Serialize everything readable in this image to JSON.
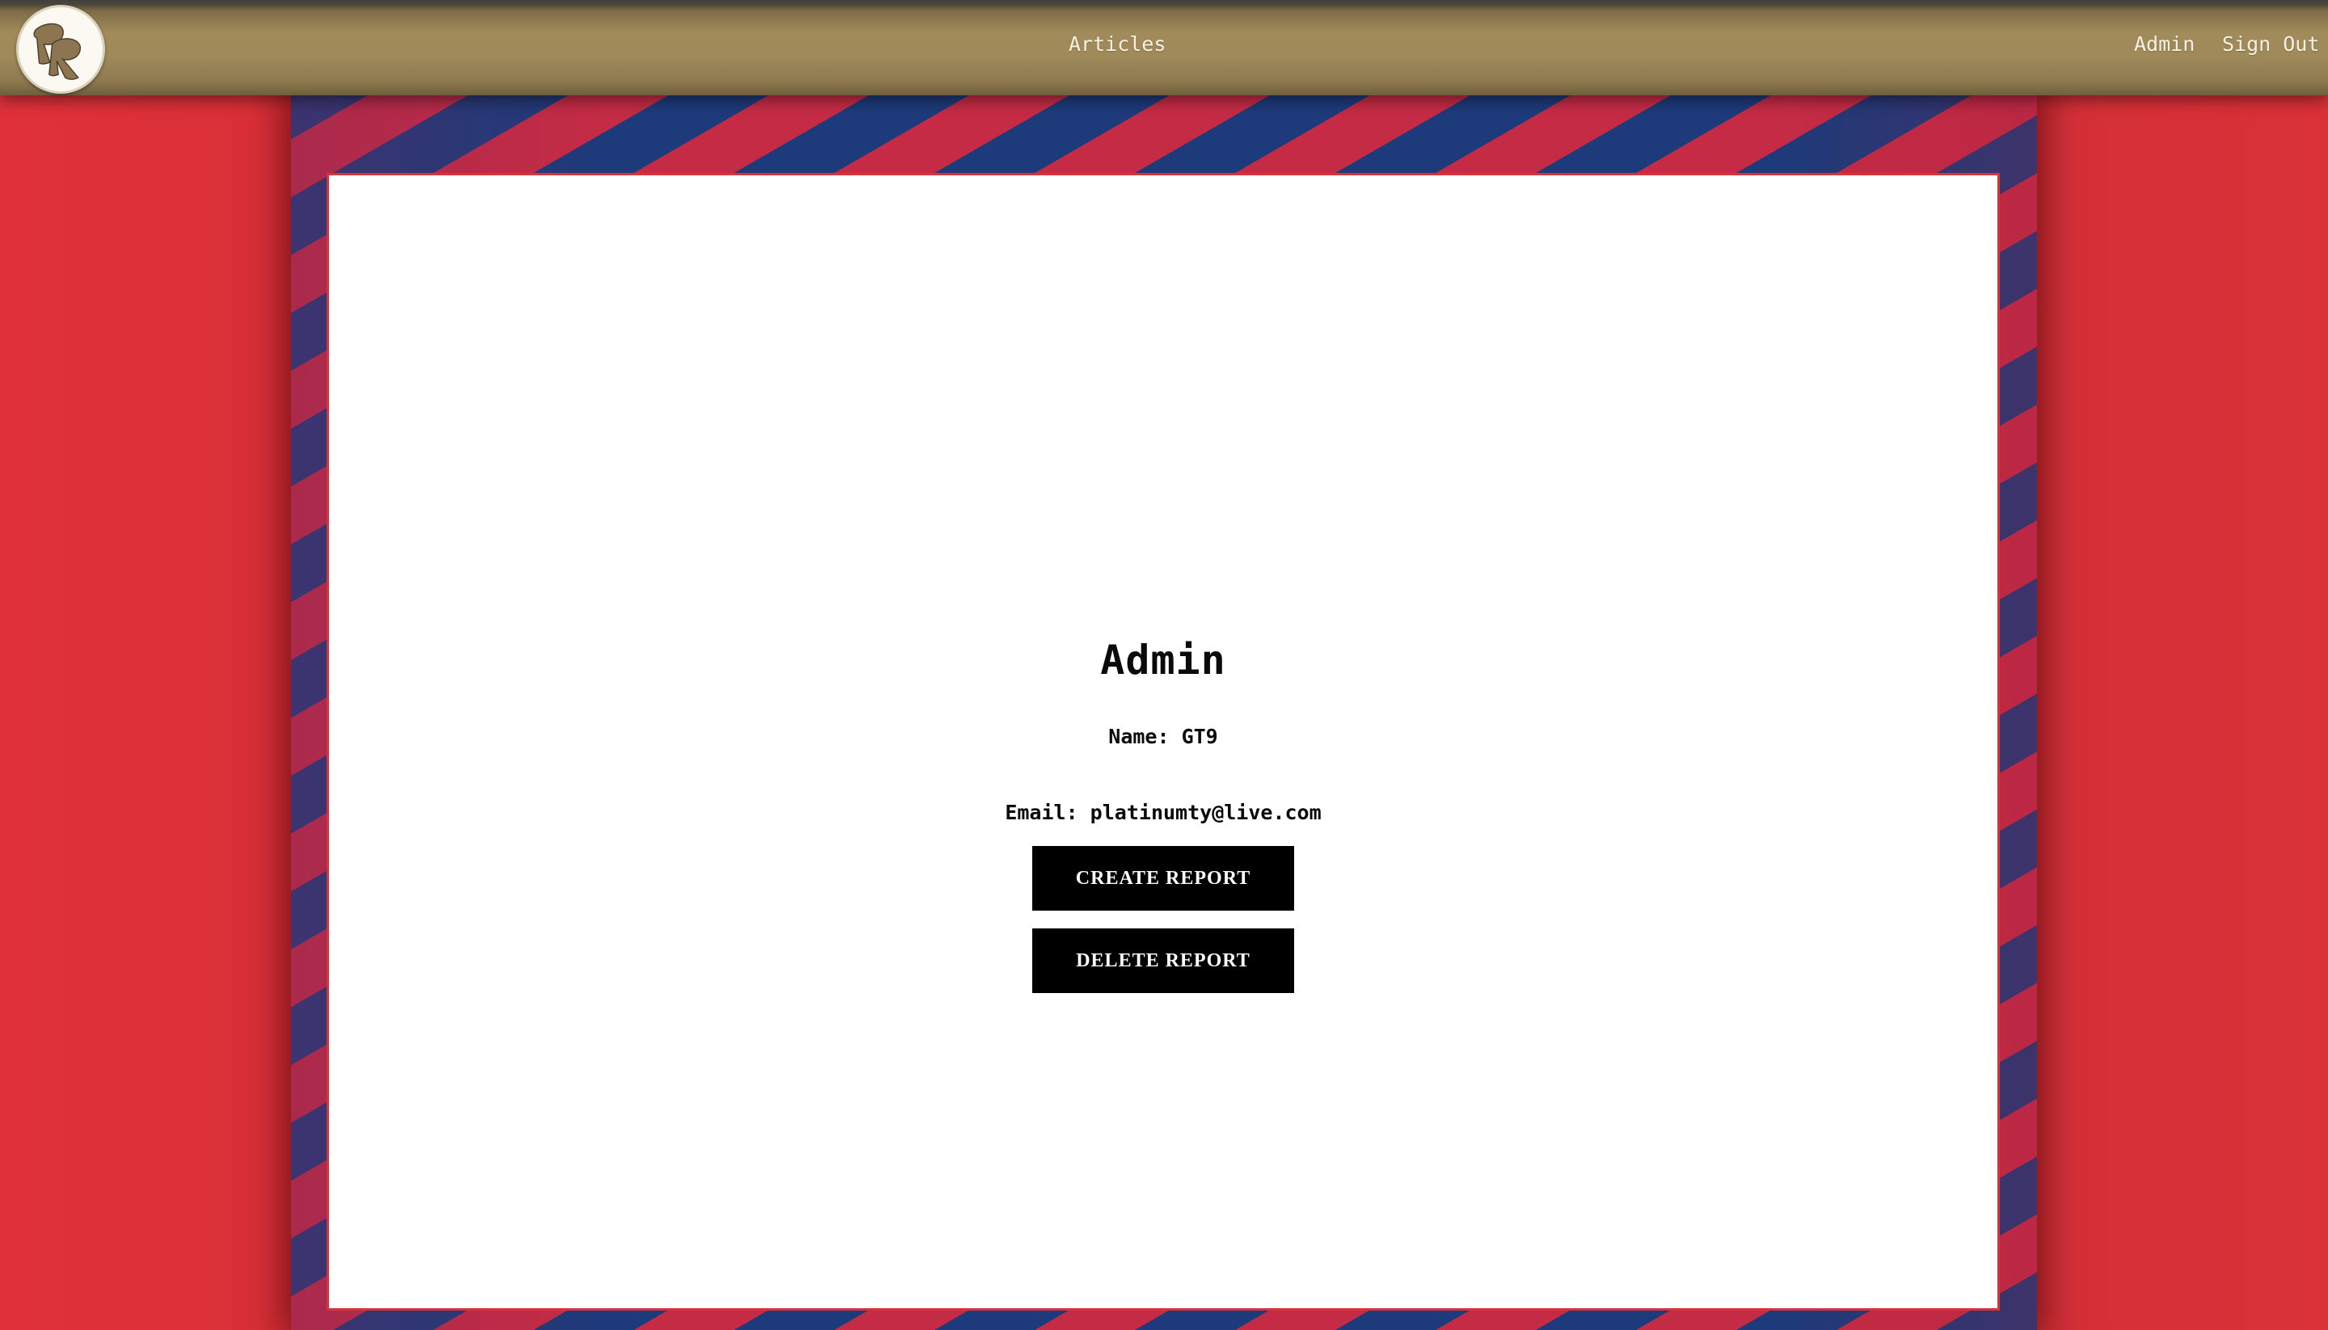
{
  "nav": {
    "logo_text": "RR",
    "articles_label": "Articles",
    "admin_label": "Admin",
    "signout_label": "Sign Out"
  },
  "admin": {
    "title": "Admin",
    "name_line": "Name: GT9",
    "email_line": "Email: platinumty@live.com",
    "create_report_label": "CREATE REPORT",
    "delete_report_label": "DELETE REPORT"
  },
  "colors": {
    "background_red": "#d42e36",
    "nav_gold": "#a18b5b",
    "stripe_blue": "#1d3a7a",
    "stripe_red": "#c52b45",
    "button_black": "#000000"
  }
}
